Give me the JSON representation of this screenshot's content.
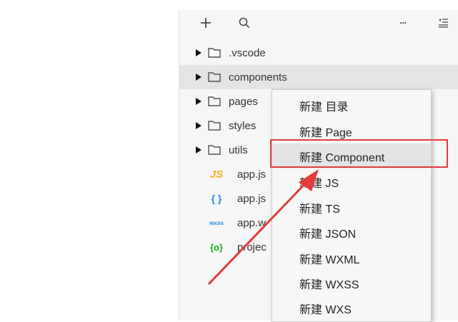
{
  "toolbar": {
    "plus_icon": "plus-icon",
    "search_icon": "search-icon",
    "more_icon": "more-icon",
    "collapse_icon": "collapse-icon",
    "more_label": "···"
  },
  "tree": [
    {
      "type": "folder",
      "name": ".vscode"
    },
    {
      "type": "folder",
      "name": "components",
      "selected": true
    },
    {
      "type": "folder",
      "name": "pages"
    },
    {
      "type": "folder",
      "name": "styles"
    },
    {
      "type": "folder",
      "name": "utils"
    },
    {
      "type": "file",
      "icon": "JS",
      "name": "app.js"
    },
    {
      "type": "file",
      "icon": "{ }",
      "name": "app.js"
    },
    {
      "type": "file",
      "icon": "wxss",
      "name": "app.w"
    },
    {
      "type": "file",
      "icon": "{o}",
      "name": "projec"
    }
  ],
  "menu": {
    "items": [
      "新建 目录",
      "新建 Page",
      "新建 Component",
      "新建 JS",
      "新建 TS",
      "新建 JSON",
      "新建 WXML",
      "新建 WXSS",
      "新建 WXS"
    ],
    "hover_index": 2
  },
  "colors": {
    "highlight": "#e23b3b",
    "js_icon": "#f2b01e",
    "json_icon": "#1e88e5",
    "config_icon": "#1aad19"
  }
}
